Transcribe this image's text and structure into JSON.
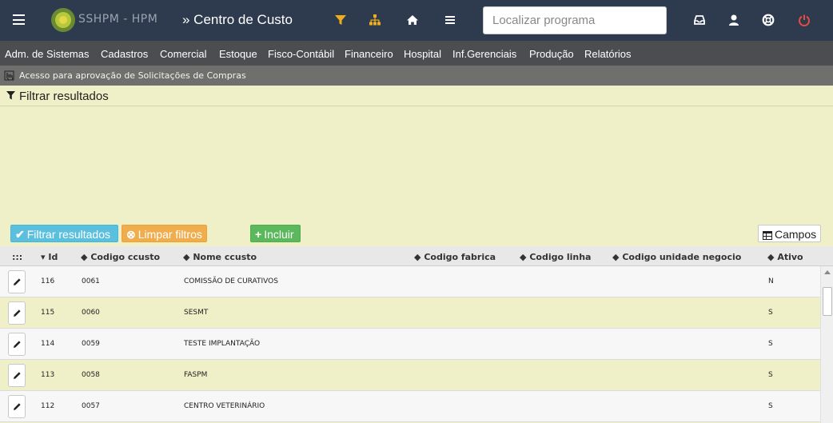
{
  "header": {
    "logo_text": "SSHPM - HPM",
    "title": "» Centro de Custo",
    "search_placeholder": "Localizar programa",
    "search_value": "",
    "icons": [
      "filter-icon",
      "sitemap-icon",
      "home-icon",
      "list-icon",
      "inbox-icon",
      "user-icon",
      "lifebuoy-icon",
      "power-icon"
    ],
    "power_color": "#e74c3c",
    "accent_color": "#f0ad1e"
  },
  "menu": {
    "items": [
      "Adm. de Sistemas",
      "Cadastros",
      "Comercial",
      "Estoque",
      "Fisco-Contábil",
      "Financeiro",
      "Hospital",
      "Inf.Gerenciais",
      "Produção",
      "Relatórios"
    ]
  },
  "notice": {
    "text": "Acesso para aprovação de Solicitações de Compras"
  },
  "filter": {
    "heading": "Filtrar resultados"
  },
  "toolbar": {
    "filter_label": "Filtrar resultados",
    "clear_label": "Limpar filtros",
    "add_label": "Incluir",
    "fields_label": "Campos"
  },
  "table": {
    "columns": {
      "drag": ":::",
      "id": "Id",
      "codigo_ccusto": "Codigo ccusto",
      "nome_ccusto": "Nome ccusto",
      "codigo_fabrica": "Codigo fabrica",
      "codigo_linha": "Codigo linha",
      "codigo_unidade_negocio": "Codigo unidade negocio",
      "ativo": "Ativo"
    },
    "rows": [
      {
        "id": "116",
        "codigo": "0061",
        "nome": "COMISSÃO DE CURATIVOS",
        "ativo": "N"
      },
      {
        "id": "115",
        "codigo": "0060",
        "nome": "SESMT",
        "ativo": "S"
      },
      {
        "id": "114",
        "codigo": "0059",
        "nome": "TESTE IMPLANTAÇÃO",
        "ativo": "S"
      },
      {
        "id": "113",
        "codigo": "0058",
        "nome": "FASPM",
        "ativo": "S"
      },
      {
        "id": "112",
        "codigo": "0057",
        "nome": "CENTRO VETERINÁRIO",
        "ativo": "S"
      }
    ]
  }
}
